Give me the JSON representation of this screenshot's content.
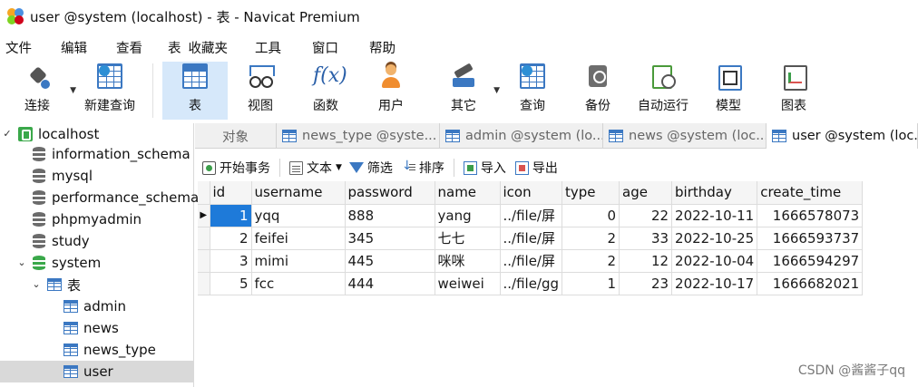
{
  "window": {
    "title": "user @system (localhost) - 表 - Navicat Premium"
  },
  "menu": [
    "文件",
    "编辑",
    "查看",
    "表",
    "收藏夹",
    "工具",
    "窗口",
    "帮助"
  ],
  "toolbar": [
    {
      "label": "连接",
      "icon": "plug-icon"
    },
    {
      "label": "新建查询",
      "icon": "new-query-icon"
    },
    {
      "label": "表",
      "icon": "table-icon"
    },
    {
      "label": "视图",
      "icon": "view-icon"
    },
    {
      "label": "函数",
      "icon": "function-icon"
    },
    {
      "label": "用户",
      "icon": "user-icon"
    },
    {
      "label": "其它",
      "icon": "other-icon"
    },
    {
      "label": "查询",
      "icon": "query-icon"
    },
    {
      "label": "备份",
      "icon": "backup-icon"
    },
    {
      "label": "自动运行",
      "icon": "auto-run-icon"
    },
    {
      "label": "模型",
      "icon": "model-icon"
    },
    {
      "label": "图表",
      "icon": "chart-icon"
    }
  ],
  "tree": {
    "connection": "localhost",
    "databases": [
      "information_schema",
      "mysql",
      "performance_schema",
      "phpmyadmin",
      "study",
      "system"
    ],
    "tables_folder": "表",
    "tables": [
      "admin",
      "news",
      "news_type",
      "user"
    ]
  },
  "tabs": {
    "objects": "对象",
    "items": [
      "news_type @syste...",
      "admin @system (lo...",
      "news @system (loc...",
      "user @system (loc..."
    ]
  },
  "subtoolbar": {
    "begin_tx": "开始事务",
    "text": "文本",
    "filter": "筛选",
    "sort": "排序",
    "import": "导入",
    "export": "导出"
  },
  "grid": {
    "columns": [
      "id",
      "username",
      "password",
      "name",
      "icon",
      "type",
      "age",
      "birthday",
      "create_time"
    ],
    "rows": [
      [
        "1",
        "yqq",
        "888",
        "yang",
        "../file/屏",
        "0",
        "22",
        "2022-10-11",
        "1666578073"
      ],
      [
        "2",
        "feifei",
        "345",
        "七七",
        "../file/屏",
        "2",
        "33",
        "2022-10-25",
        "1666593737"
      ],
      [
        "3",
        "mimi",
        "445",
        "咪咪",
        "../file/屏",
        "2",
        "12",
        "2022-10-04",
        "1666594297"
      ],
      [
        "5",
        "fcc",
        "444",
        "weiwei",
        "../file/gg",
        "1",
        "23",
        "2022-10-17",
        "1666682021"
      ]
    ]
  },
  "watermark": "CSDN @酱酱子qq"
}
